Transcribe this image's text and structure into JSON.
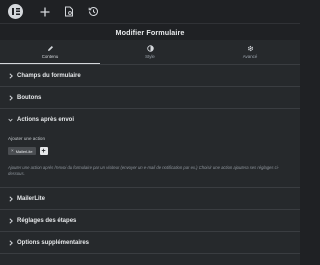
{
  "topbar": {
    "icons": [
      "elementor-logo-icon",
      "plus-icon",
      "document-settings-icon",
      "history-icon"
    ]
  },
  "header": {
    "title": "Modifier Formulaire"
  },
  "tabs": [
    {
      "label": "Contenu",
      "icon": "pencil-icon",
      "active": true
    },
    {
      "label": "Style",
      "icon": "half-circle-icon",
      "active": false
    },
    {
      "label": "Avancé",
      "icon": "gear-icon",
      "active": false
    }
  ],
  "sections": {
    "form_fields": "Champs du formulaire",
    "buttons": "Boutons",
    "actions_after_submit": "Actions après envoi",
    "mailerlite": "MailerLite",
    "steps_settings": "Réglages des étapes",
    "additional_options": "Options supplémentaires"
  },
  "actions_panel": {
    "add_action_label": "Ajouter une action",
    "tags": [
      "MailerLite"
    ],
    "remove_symbol": "×",
    "add_symbol": "+",
    "description": "Ajouter une action après l'envoi du formulaire par un visiteur (envoyer un e-mail de notification par ex.) Choisir une action ajoutera ses réglages ci-dessous."
  },
  "colors": {
    "background": "#26292c",
    "topbar": "#1f2124",
    "text": "#d5d8dc",
    "divider": "#3a3d41"
  }
}
